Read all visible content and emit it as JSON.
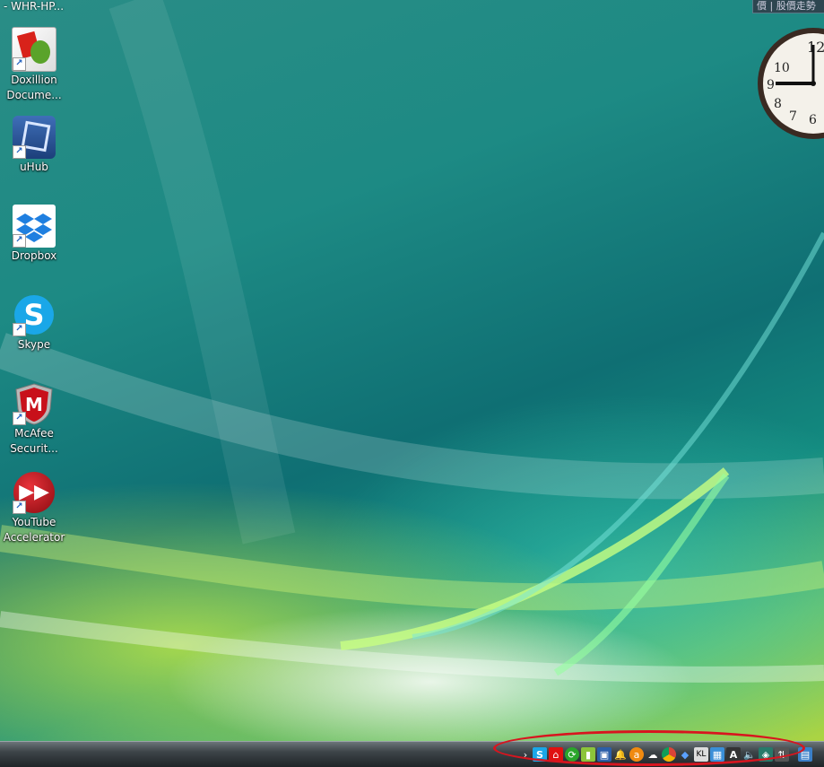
{
  "window_title_fragment": "- WHR-HP...",
  "gadget_tab": "價 | 股價走勢",
  "desktop_icons": [
    {
      "label_line1": "Doxillion",
      "label_line2": "Docume..."
    },
    {
      "label_line1": "uHub",
      "label_line2": ""
    },
    {
      "label_line1": "Dropbox",
      "label_line2": ""
    },
    {
      "label_line1": "Skype",
      "label_line2": ""
    },
    {
      "label_line1": "McAfee",
      "label_line2": "Securit..."
    },
    {
      "label_line1": "YouTube",
      "label_line2": "Accelerator"
    }
  ],
  "clock": {
    "numerals": [
      "12",
      "10",
      "9",
      "8",
      "7",
      "6"
    ]
  },
  "tray": {
    "expand_label": "›",
    "icons": [
      "skype-tray-icon",
      "home-red-icon",
      "sync-green-icon",
      "battery-icon",
      "monitor-icon",
      "bell-icon",
      "avast-icon",
      "cloud-icon",
      "chrome-icon",
      "dropbox-tray-icon",
      "keyboard-icon",
      "network-icon",
      "acrobat-icon",
      "speaker-icon",
      "shield-icon",
      "update-icon",
      "network-2-icon"
    ]
  },
  "colors": {
    "highlight": "#d8151f",
    "taskbar": "#3d4448"
  }
}
